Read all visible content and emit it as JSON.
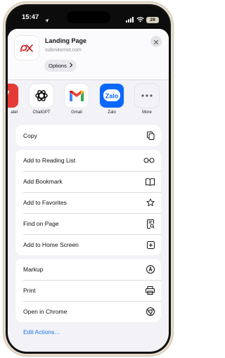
{
  "status_bar": {
    "time": "15:47",
    "battery": "29"
  },
  "header": {
    "title": "Landing Page",
    "subtitle": "submitornot.com",
    "options_label": "Options"
  },
  "apps": [
    {
      "label": "atel",
      "icon": "red-app-icon"
    },
    {
      "label": "ChatGPT",
      "icon": "chatgpt-icon"
    },
    {
      "label": "Gmail",
      "icon": "gmail-icon"
    },
    {
      "label": "Zalo",
      "icon": "zalo-icon"
    },
    {
      "label": "More",
      "icon": "more-icon"
    }
  ],
  "actions": {
    "copy": "Copy",
    "reading_list": "Add to Reading List",
    "bookmark": "Add Bookmark",
    "favorites": "Add to Favorites",
    "find": "Find on Page",
    "home_screen": "Add to Home Screen",
    "markup": "Markup",
    "print": "Print",
    "open_chrome": "Open in Chrome"
  },
  "edit_actions": "Edit Actions...",
  "colors": {
    "accent": "#1a73e8",
    "sheet_bg": "#f2f2f7",
    "logo_red": "#c5161d"
  }
}
